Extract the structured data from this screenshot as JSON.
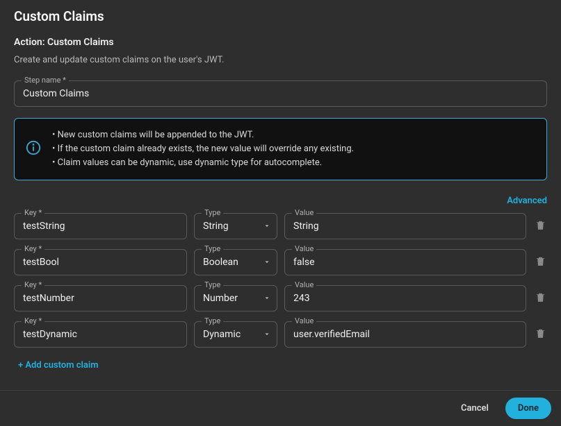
{
  "header": {
    "title": "Custom Claims",
    "subtitle": "Action: Custom Claims",
    "description": "Create and update custom claims on the user's JWT."
  },
  "stepName": {
    "label": "Step name *",
    "value": "Custom Claims"
  },
  "info": {
    "lines": [
      "New custom claims will be appended to the JWT.",
      "If the custom claim already exists, the new value will override any existing.",
      "Claim values can be dynamic, use dynamic type for autocomplete."
    ]
  },
  "advancedLabel": "Advanced",
  "labels": {
    "key": "Key *",
    "type": "Type",
    "value": "Value"
  },
  "typeOptions": [
    "String",
    "Boolean",
    "Number",
    "Dynamic"
  ],
  "claims": [
    {
      "key": "testString",
      "type": "String",
      "value": "String"
    },
    {
      "key": "testBool",
      "type": "Boolean",
      "value": "false"
    },
    {
      "key": "testNumber",
      "type": "Number",
      "value": "243"
    },
    {
      "key": "testDynamic",
      "type": "Dynamic",
      "value": "user.verifiedEmail"
    }
  ],
  "addLabel": "+ Add custom claim",
  "footer": {
    "cancel": "Cancel",
    "done": "Done"
  }
}
